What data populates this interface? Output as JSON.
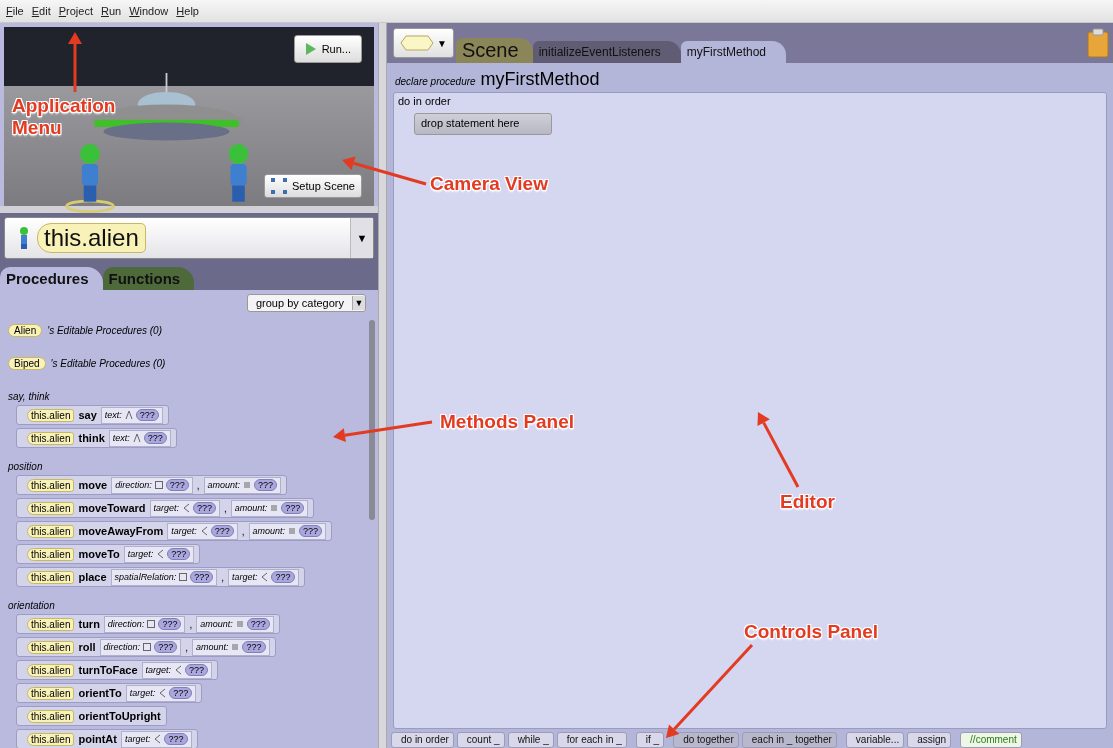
{
  "menu": [
    "File",
    "Edit",
    "Project",
    "Run",
    "Window",
    "Help"
  ],
  "camera_view": {
    "run_button": "Run...",
    "setup_button": "Setup Scene"
  },
  "object_selector": {
    "value": "this.alien",
    "arrow": "▼"
  },
  "member_tabs": [
    {
      "label": "Procedures",
      "selected": true
    },
    {
      "label": "Functions",
      "selected": false
    }
  ],
  "group_by": {
    "value": "group by category",
    "arrow": "▼"
  },
  "type_selector": {
    "arrow": "▼"
  },
  "sections": [
    {
      "kind": "editable",
      "type_name": "Alien",
      "text": "'s Editable Procedures (0)"
    },
    {
      "kind": "editable",
      "type_name": "Biped",
      "text": "'s Editable Procedures (0)"
    },
    {
      "kind": "category",
      "title": "say, think",
      "methods": [
        {
          "target": "this.alien",
          "name": "say",
          "params": [
            {
              "label": "text:",
              "kind": "text",
              "value": "???"
            }
          ]
        },
        {
          "target": "this.alien",
          "name": "think",
          "params": [
            {
              "label": "text:",
              "kind": "text",
              "value": "???"
            }
          ]
        }
      ]
    },
    {
      "kind": "category",
      "title": "position",
      "methods": [
        {
          "target": "this.alien",
          "name": "move",
          "separator": ",",
          "params": [
            {
              "label": "direction:",
              "kind": "enum",
              "value": "???"
            },
            {
              "label": "amount:",
              "kind": "number",
              "value": "???"
            }
          ]
        },
        {
          "target": "this.alien",
          "name": "moveToward",
          "separator": ",",
          "params": [
            {
              "label": "target:",
              "kind": "object",
              "value": "???"
            },
            {
              "label": "amount:",
              "kind": "number",
              "value": "???"
            }
          ]
        },
        {
          "target": "this.alien",
          "name": "moveAwayFrom",
          "separator": ",",
          "params": [
            {
              "label": "target:",
              "kind": "object",
              "value": "???"
            },
            {
              "label": "amount:",
              "kind": "number",
              "value": "???"
            }
          ]
        },
        {
          "target": "this.alien",
          "name": "moveTo",
          "params": [
            {
              "label": "target:",
              "kind": "object",
              "value": "???"
            }
          ]
        },
        {
          "target": "this.alien",
          "name": "place",
          "separator": ",",
          "params": [
            {
              "label": "spatialRelation:",
              "kind": "enum",
              "value": "???"
            },
            {
              "label": "target:",
              "kind": "object",
              "value": "???"
            }
          ]
        }
      ]
    },
    {
      "kind": "category",
      "title": "orientation",
      "methods": [
        {
          "target": "this.alien",
          "name": "turn",
          "separator": ",",
          "params": [
            {
              "label": "direction:",
              "kind": "enum",
              "value": "???"
            },
            {
              "label": "amount:",
              "kind": "number",
              "value": "???"
            }
          ]
        },
        {
          "target": "this.alien",
          "name": "roll",
          "separator": ",",
          "params": [
            {
              "label": "direction:",
              "kind": "enum",
              "value": "???"
            },
            {
              "label": "amount:",
              "kind": "number",
              "value": "???"
            }
          ]
        },
        {
          "target": "this.alien",
          "name": "turnToFace",
          "params": [
            {
              "label": "target:",
              "kind": "object",
              "value": "???"
            }
          ]
        },
        {
          "target": "this.alien",
          "name": "orientTo",
          "params": [
            {
              "label": "target:",
              "kind": "object",
              "value": "???"
            }
          ]
        },
        {
          "target": "this.alien",
          "name": "orientToUpright"
        },
        {
          "target": "this.alien",
          "name": "pointAt",
          "params": [
            {
              "label": "target:",
              "kind": "object",
              "value": "???"
            }
          ]
        }
      ]
    }
  ],
  "editor_tabs": [
    {
      "label": "Scene",
      "kind": "scene",
      "selected": false
    },
    {
      "label": "initializeEventListeners",
      "kind": "method",
      "selected": false
    },
    {
      "label": "myFirstMethod",
      "kind": "method",
      "selected": true
    }
  ],
  "editor": {
    "declare_label": "declare procedure",
    "procedure_name": "myFirstMethod",
    "block_label": "do in order",
    "drop_hint": "drop statement here"
  },
  "controls": [
    {
      "label": "do in order",
      "kind": "statement"
    },
    {
      "label": "count _",
      "kind": "statement"
    },
    {
      "label": "while _",
      "kind": "statement"
    },
    {
      "label": "for each in _",
      "kind": "statement"
    },
    {
      "label": "if _",
      "kind": "statement"
    },
    {
      "label": "do together",
      "kind": "parallel"
    },
    {
      "label": "each in _ together",
      "kind": "parallel"
    },
    {
      "label": "variable...",
      "kind": "statement"
    },
    {
      "label": "assign",
      "kind": "statement"
    },
    {
      "label": "//comment",
      "kind": "comment"
    }
  ],
  "annotations": [
    {
      "label": "Application Menu"
    },
    {
      "label": "Camera View"
    },
    {
      "label": "Methods Panel"
    },
    {
      "label": "Editor"
    },
    {
      "label": "Controls Panel"
    }
  ]
}
